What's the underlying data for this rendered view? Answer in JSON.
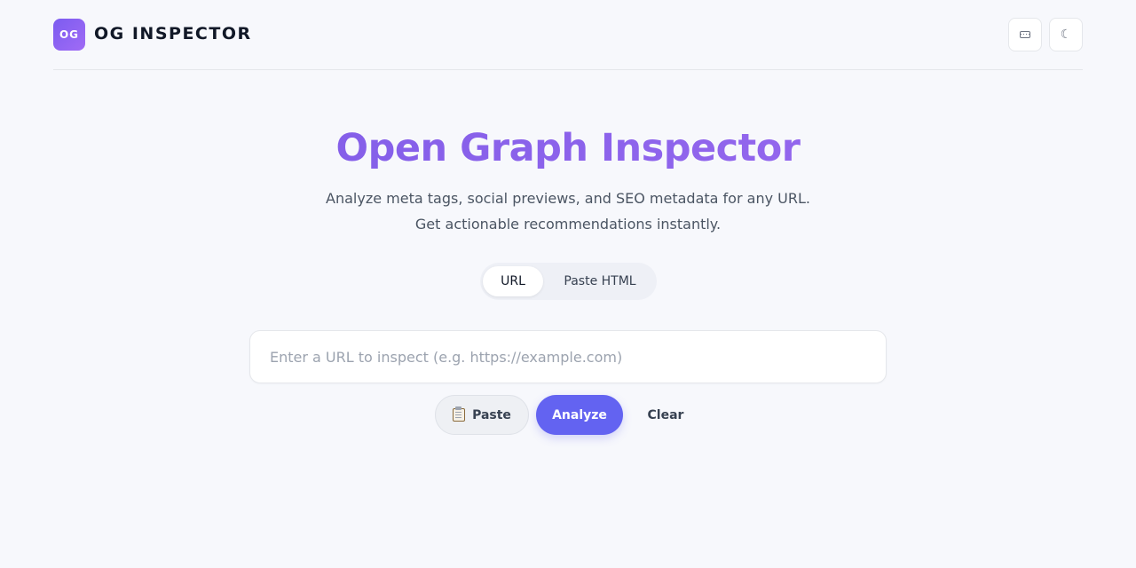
{
  "header": {
    "logo_text": "OG",
    "brand": "OG INSPECTOR",
    "keyboard_icon": "keyboard-icon",
    "theme_icon": "moon-icon",
    "theme_glyph": "☾"
  },
  "hero": {
    "title": "Open Graph Inspector",
    "subtitle_line1": "Analyze meta tags, social previews, and SEO metadata for any URL.",
    "subtitle_line2": "Get actionable recommendations instantly."
  },
  "mode_tabs": {
    "items": [
      {
        "label": "URL",
        "active": true
      },
      {
        "label": "Paste HTML",
        "active": false
      }
    ]
  },
  "search": {
    "value": "",
    "placeholder": "Enter a URL to inspect (e.g. https://example.com)"
  },
  "actions": {
    "paste_label": "Paste",
    "paste_icon": "clipboard-icon",
    "analyze_label": "Analyze",
    "clear_label": "Clear"
  },
  "colors": {
    "accent": "#6363f1",
    "title_gradient_start": "#7b5ae6",
    "title_gradient_end": "#9c6bf0",
    "background": "#f7f8fc"
  }
}
